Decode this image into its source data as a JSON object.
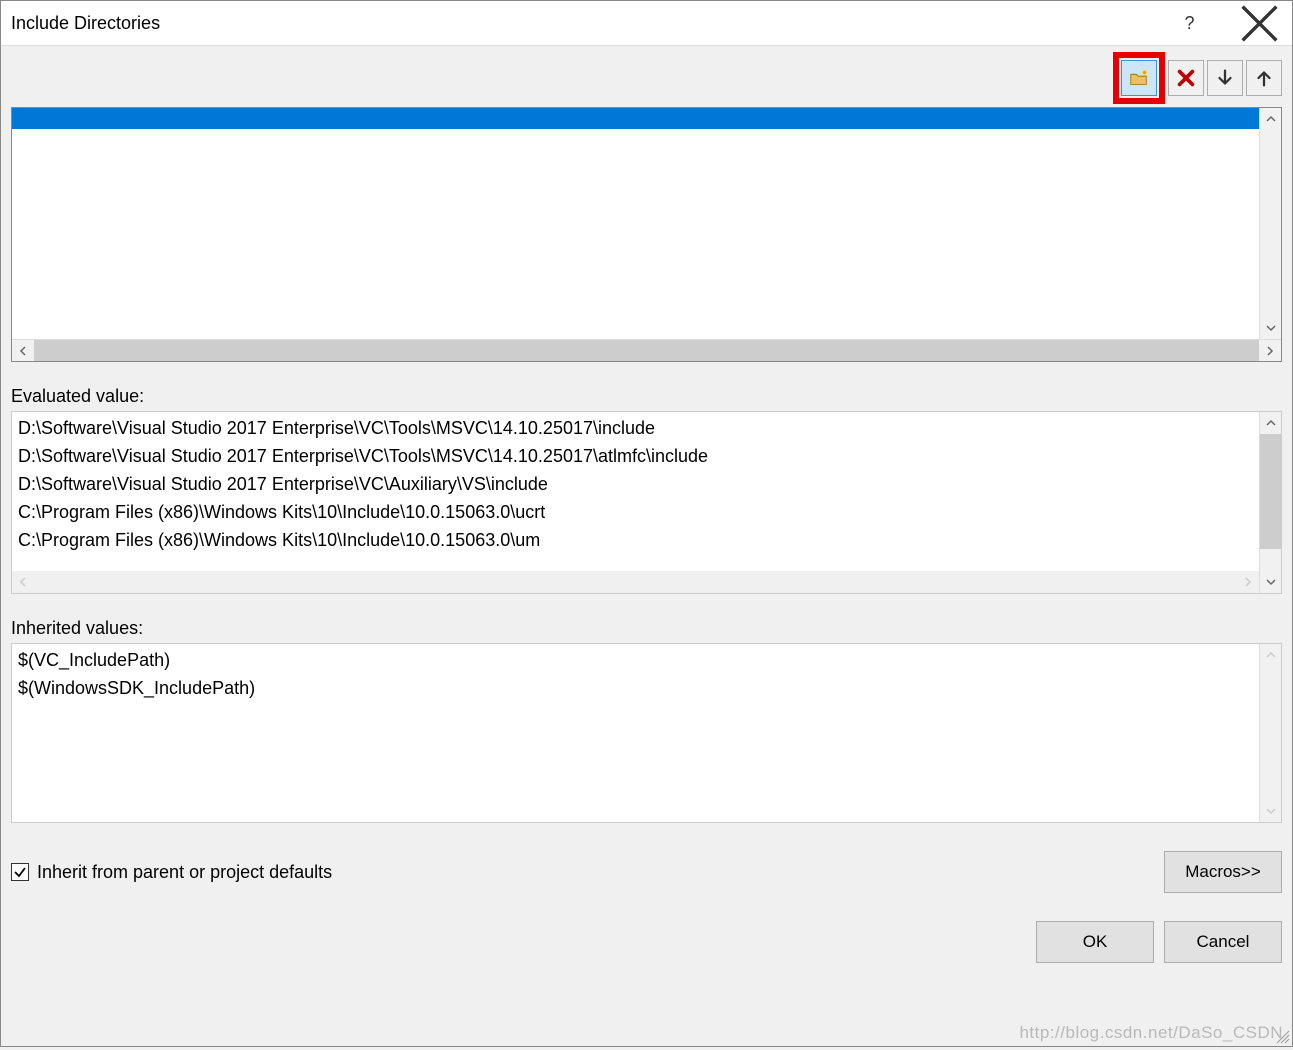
{
  "title": "Include Directories",
  "toolbar": {
    "new_tooltip": "New Line",
    "delete_tooltip": "Delete",
    "move_down_tooltip": "Move Down",
    "move_up_tooltip": "Move Up"
  },
  "edit_list": {
    "rows": [
      ""
    ]
  },
  "evaluated": {
    "label": "Evaluated value:",
    "values": [
      "D:\\Software\\Visual Studio 2017 Enterprise\\VC\\Tools\\MSVC\\14.10.25017\\include",
      "D:\\Software\\Visual Studio 2017 Enterprise\\VC\\Tools\\MSVC\\14.10.25017\\atlmfc\\include",
      "D:\\Software\\Visual Studio 2017 Enterprise\\VC\\Auxiliary\\VS\\include",
      "C:\\Program Files (x86)\\Windows Kits\\10\\Include\\10.0.15063.0\\ucrt",
      "C:\\Program Files (x86)\\Windows Kits\\10\\Include\\10.0.15063.0\\um"
    ]
  },
  "inherited": {
    "label": "Inherited values:",
    "values": [
      "$(VC_IncludePath)",
      "$(WindowsSDK_IncludePath)"
    ]
  },
  "inherit_checkbox": {
    "checked": true,
    "label": "Inherit from parent or project defaults"
  },
  "buttons": {
    "macros": "Macros>>",
    "ok": "OK",
    "cancel": "Cancel"
  },
  "watermark": "http://blog.csdn.net/DaSo_CSDN"
}
